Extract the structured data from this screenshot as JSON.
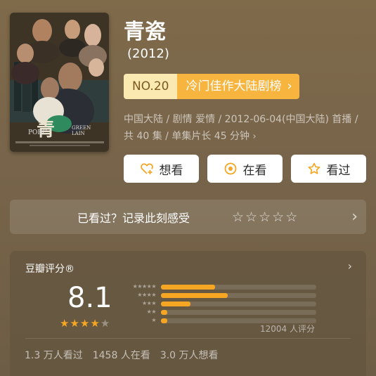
{
  "movie": {
    "title": "青瓷",
    "year": "(2012)",
    "poster": {
      "cn_title": "青",
      "en_line1": "PORC",
      "en_line2": "GREEN\nLAIN"
    },
    "rank": {
      "no": "NO.20",
      "list": "冷门佳作大陆剧榜"
    },
    "meta": "中国大陆 / 剧情 爱情 / 2012-06-04(中国大陆) 首播 / 共 40 集 / 单集片长 45 分钟"
  },
  "actions": [
    {
      "label": "想看",
      "icon": "heart-plus-icon"
    },
    {
      "label": "在看",
      "icon": "circle-dot-icon"
    },
    {
      "label": "看过",
      "icon": "star-outline-icon"
    }
  ],
  "record": {
    "label": "已看过？记录此刻感受",
    "stars": 5
  },
  "rating": {
    "title": "豆瓣评分®",
    "score": "8.1",
    "stars_display": 4,
    "count": "12004 人评分",
    "distribution": [
      {
        "stars": 5,
        "fraction": 0.35
      },
      {
        "stars": 4,
        "fraction": 0.43
      },
      {
        "stars": 3,
        "fraction": 0.19
      },
      {
        "stars": 2,
        "fraction": 0.04
      },
      {
        "stars": 1,
        "fraction": 0.04
      }
    ],
    "stats": [
      "1.3 万人看过",
      "1458 人在看",
      "3.0 万人想看"
    ]
  },
  "colors": {
    "accent": "#f6a623",
    "rank_bg": "#fbe9b2",
    "rank_list_bg": "#f7b53f"
  }
}
